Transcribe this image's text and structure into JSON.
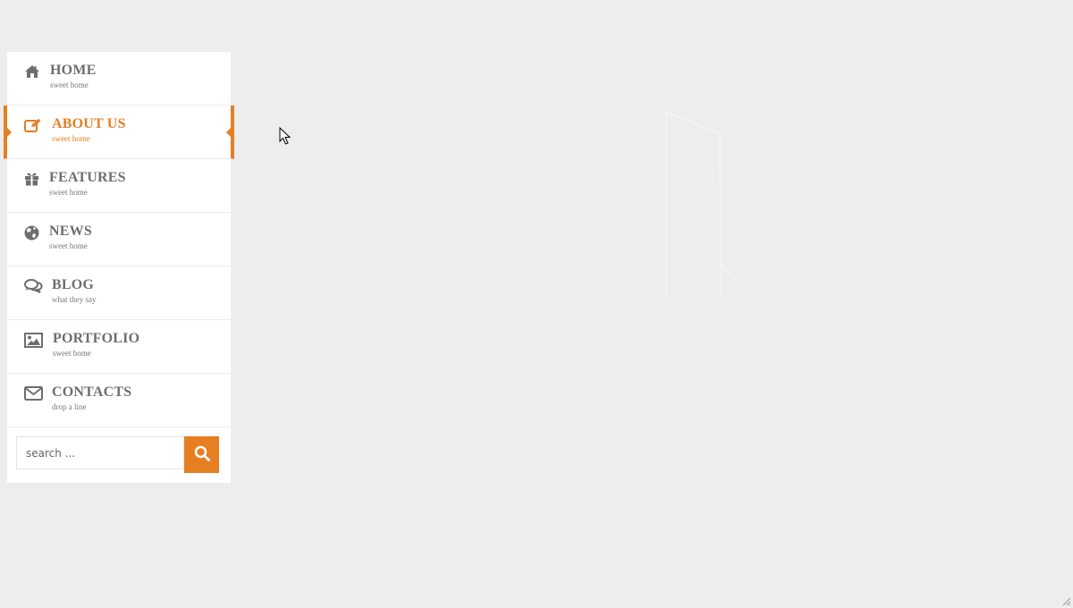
{
  "menu": {
    "items": [
      {
        "title": "HOME",
        "subtitle": "sweet home",
        "icon": "home-icon"
      },
      {
        "title": "ABOUT US",
        "subtitle": "sweet home",
        "icon": "edit-icon",
        "active": true
      },
      {
        "title": "FEATURES",
        "subtitle": "sweet home",
        "icon": "gift-icon"
      },
      {
        "title": "NEWS",
        "subtitle": "sweet home",
        "icon": "globe-icon"
      },
      {
        "title": "BLOG",
        "subtitle": "what they say",
        "icon": "comments-icon"
      },
      {
        "title": "PORTFOLIO",
        "subtitle": "sweet home",
        "icon": "picture-icon"
      },
      {
        "title": "CONTACTS",
        "subtitle": "drop a line",
        "icon": "envelope-icon"
      }
    ]
  },
  "search": {
    "placeholder": "search ...",
    "button_icon": "search-icon"
  },
  "colors": {
    "accent": "#e67e22",
    "text": "#6e6e6e",
    "background": "#ededed",
    "menu_bg": "#ffffff"
  }
}
